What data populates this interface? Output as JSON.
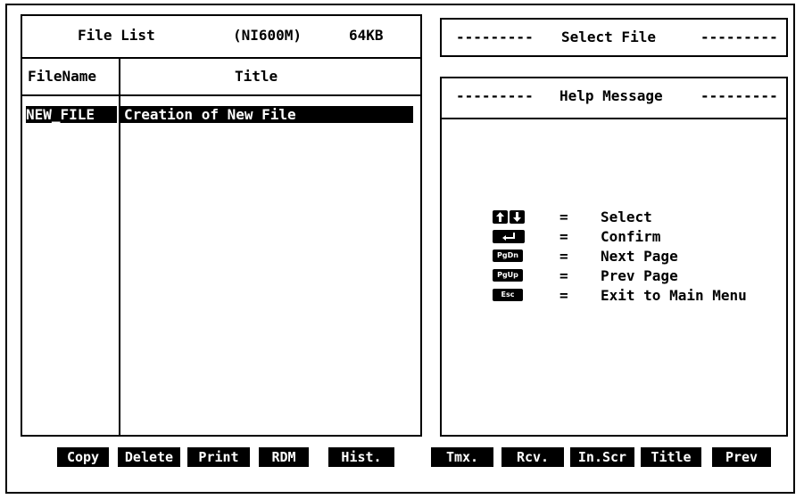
{
  "file_list": {
    "title": "File List",
    "model": "(NI600M)",
    "capacity": "64KB",
    "col_filename": "FileName",
    "col_title": "Title",
    "rows": [
      {
        "filename": "NEW_FILE",
        "title": "Creation of New File"
      }
    ]
  },
  "select_panel": {
    "dashes_left": "---------",
    "title": "Select File",
    "dashes_right": "---------"
  },
  "help_panel": {
    "dashes_left": "---------",
    "title": "Help Message",
    "dashes_right": "---------",
    "items": [
      {
        "key": "arrow-up-down-icon",
        "eq": "=",
        "text": "Select"
      },
      {
        "key": "enter-key-icon",
        "eq": "=",
        "text": "Confirm"
      },
      {
        "key_label": "PgDn",
        "eq": "=",
        "text": "Next Page"
      },
      {
        "key_label": "PgUp",
        "eq": "=",
        "text": "Prev Page"
      },
      {
        "key_label": "Esc",
        "eq": "=",
        "text": "Exit to Main Menu"
      }
    ]
  },
  "function_keys": [
    "Copy",
    "Delete",
    "Print",
    "RDM",
    "Hist.",
    "Tmx.",
    "Rcv.",
    "In.Scr",
    "Title",
    "Prev"
  ]
}
